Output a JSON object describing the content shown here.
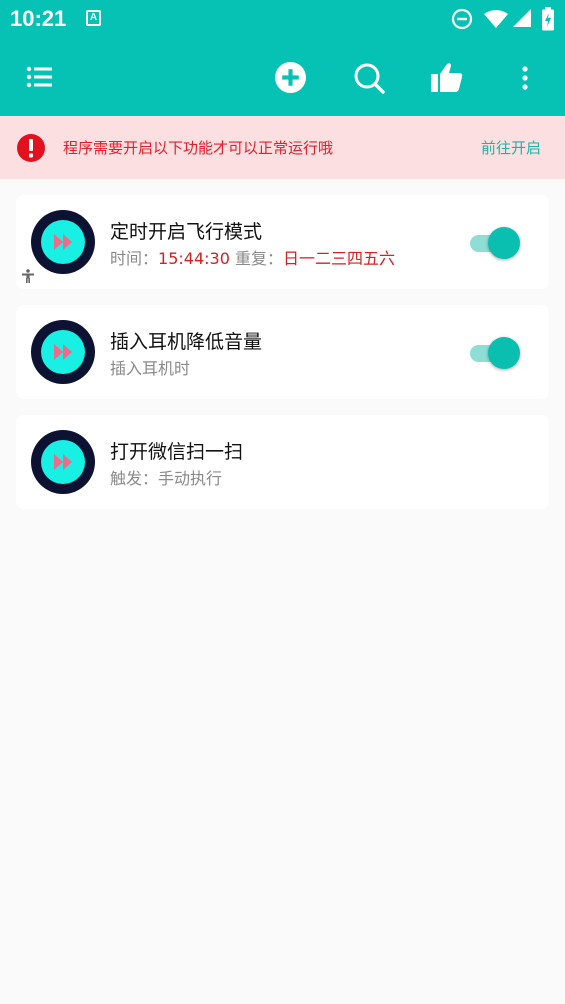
{
  "status_bar": {
    "time": "10:21",
    "a_badge": "A",
    "icons": [
      "notification-a-icon",
      "do-not-disturb-icon",
      "wifi-icon",
      "signal-icon",
      "battery-charging-icon"
    ]
  },
  "toolbar": {
    "icons": [
      "menu-list-icon",
      "add-icon",
      "search-icon",
      "thumbs-up-icon",
      "more-vert-icon"
    ]
  },
  "warning": {
    "message": "程序需要开启以下功能才可以正常运行哦",
    "action": "前往开启",
    "colors": {
      "background": "#fcdfe0",
      "text": "#e0202c",
      "action": "#19b5a8"
    }
  },
  "tasks": [
    {
      "title": "定时开启飞行模式",
      "sub_label_time": "时间：",
      "time": "15:44:30",
      "sub_label_repeat": " 重复：",
      "repeat": "日一二三四五六",
      "enabled": true
    },
    {
      "title": "插入耳机降低音量",
      "subtitle": "插入耳机时",
      "enabled": true
    },
    {
      "title": "打开微信扫一扫",
      "subtitle": "触发：手动执行"
    }
  ],
  "colors": {
    "primary": "#06c2b4",
    "accent": "#0bbfb0",
    "background": "#fafafa"
  }
}
